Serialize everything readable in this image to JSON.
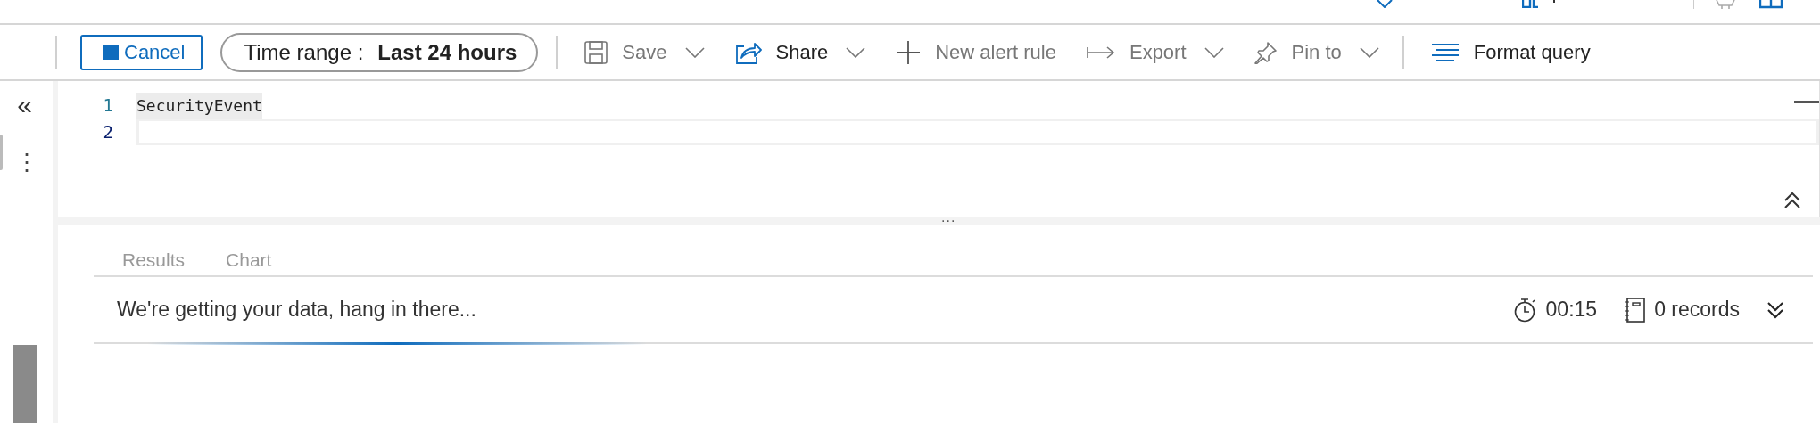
{
  "toolbar": {
    "cancel": "Cancel",
    "time_range": {
      "label": "Time range :",
      "value": "Last 24 hours"
    },
    "items": [
      {
        "kind": "save",
        "label": "Save",
        "disabled": true,
        "dropdown": true
      },
      {
        "kind": "share",
        "label": "Share",
        "disabled": false,
        "dropdown": true
      },
      {
        "kind": "alert",
        "label": "New alert rule",
        "disabled": true,
        "dropdown": false
      },
      {
        "kind": "export",
        "label": "Export",
        "disabled": true,
        "dropdown": true
      },
      {
        "kind": "pin",
        "label": "Pin to",
        "disabled": true,
        "dropdown": true
      },
      {
        "kind": "format",
        "label": "Format query",
        "disabled": false,
        "dropdown": false
      }
    ]
  },
  "sidebar": {
    "collapse": "«",
    "more": "⋮"
  },
  "editor": {
    "lines": [
      {
        "number": "1",
        "code": "SecurityEvent"
      },
      {
        "number": "2"
      }
    ],
    "splitter": "..."
  },
  "results": {
    "tabs": [
      {
        "label": "Results",
        "selected": false
      },
      {
        "label": "Chart",
        "selected": false
      }
    ],
    "status": "We're getting your data, hang in there...",
    "elapsed": "00:15",
    "records": "0 records"
  }
}
